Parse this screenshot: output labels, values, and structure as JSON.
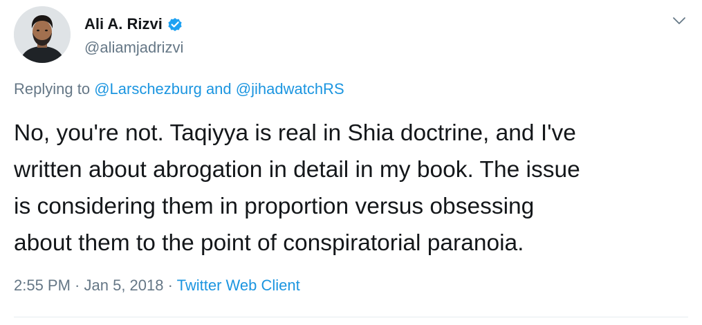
{
  "author": {
    "display_name": "Ali A. Rizvi",
    "handle": "@aliamjadrizvi",
    "verified": true,
    "avatar_icon": "profile-photo"
  },
  "menu": {
    "icon": "chevron-down-icon"
  },
  "reply": {
    "prefix": "Replying to ",
    "user1": "@Larschezburg",
    "connector": " and ",
    "user2": "@jihadwatchRS"
  },
  "tweet": {
    "text": "No, you're not. Taqiyya is real in Shia doctrine, and I've\nwritten about abrogation in detail in my book. The issue\nis considering them in proportion versus obsessing\nabout them to the point of conspiratorial paranoia."
  },
  "meta": {
    "time": "2:55 PM",
    "sep1": " · ",
    "date": "Jan 5, 2018",
    "sep2": " · ",
    "client": "Twitter Web Client"
  },
  "colors": {
    "text": "#14171a",
    "secondary": "#657786",
    "link": "#1b95e0",
    "verified_badge": "#1da1f2",
    "divider": "#e6ecf0"
  }
}
